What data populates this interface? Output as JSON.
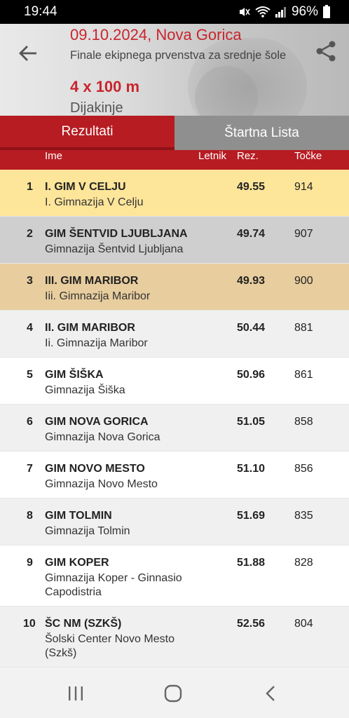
{
  "status": {
    "time": "19:44",
    "battery": "96%"
  },
  "header": {
    "date_place": "09.10.2024, Nova Gorica",
    "subtitle": "Finale ekipnega prvenstva za srednje šole",
    "discipline": "4 x 100 m",
    "category": "Dijakinje"
  },
  "tabs": [
    {
      "label": "Rezultati"
    },
    {
      "label": "Štartna Lista"
    }
  ],
  "columns": {
    "name": "Ime",
    "year": "Letnik",
    "result": "Rez.",
    "points": "Točke"
  },
  "rows": [
    {
      "rank": "1",
      "name": "I. GIM V CELJU",
      "school": "I. Gimnazija V Celju",
      "result": "49.55",
      "points": "914",
      "bg": "#fde59a"
    },
    {
      "rank": "2",
      "name": "GIM ŠENTVID LJUBLJANA",
      "school": "Gimnazija Šentvid Ljubljana",
      "result": "49.74",
      "points": "907",
      "bg": "#cfcfcf"
    },
    {
      "rank": "3",
      "name": "III. GIM MARIBOR",
      "school": "Iii. Gimnazija Maribor",
      "result": "49.93",
      "points": "900",
      "bg": "#e8cd9e"
    },
    {
      "rank": "4",
      "name": "II. GIM MARIBOR",
      "school": "Ii. Gimnazija Maribor",
      "result": "50.44",
      "points": "881",
      "bg": "#f0f0f0"
    },
    {
      "rank": "5",
      "name": "GIM ŠIŠKA",
      "school": "Gimnazija Šiška",
      "result": "50.96",
      "points": "861",
      "bg": "#ffffff"
    },
    {
      "rank": "6",
      "name": "GIM NOVA GORICA",
      "school": "Gimnazija Nova Gorica",
      "result": "51.05",
      "points": "858",
      "bg": "#f0f0f0"
    },
    {
      "rank": "7",
      "name": "GIM NOVO MESTO",
      "school": "Gimnazija Novo Mesto",
      "result": "51.10",
      "points": "856",
      "bg": "#ffffff"
    },
    {
      "rank": "8",
      "name": "GIM TOLMIN",
      "school": "Gimnazija Tolmin",
      "result": "51.69",
      "points": "835",
      "bg": "#f0f0f0"
    },
    {
      "rank": "9",
      "name": "GIM KOPER",
      "school": "Gimnazija Koper - Ginnasio Capodistria",
      "result": "51.88",
      "points": "828",
      "bg": "#ffffff"
    },
    {
      "rank": "10",
      "name": "ŠC NM (SZKŠ)",
      "school": "Šolski Center Novo Mesto (Szkš)",
      "result": "52.56",
      "points": "804",
      "bg": "#f0f0f0"
    }
  ],
  "colors": {
    "accent": "#b71c22",
    "accent_text": "#c8252c"
  }
}
